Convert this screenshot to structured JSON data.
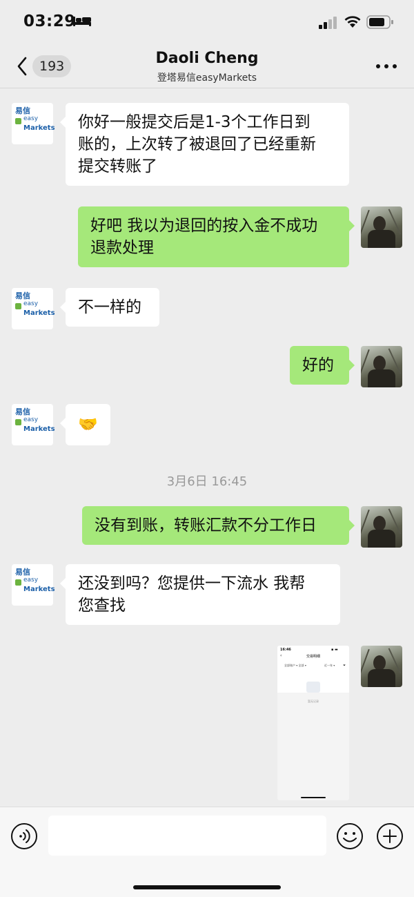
{
  "status_bar": {
    "time": "03:29",
    "sleep_icon": "bed-icon",
    "signal_icon": "cellular-signal-icon",
    "wifi_icon": "wifi-icon",
    "battery_icon": "battery-icon"
  },
  "nav": {
    "unread_count": "193",
    "title": "Daoli Cheng",
    "subtitle": "登塔易信easyMarkets",
    "back_icon": "chevron-left-icon",
    "more_icon": "more-dots-icon"
  },
  "logo": {
    "cn": "易信",
    "easy": "easy",
    "markets": "Markets"
  },
  "messages": [
    {
      "side": "in",
      "lines": [
        "你好一般提交后是1-3个工作日到",
        "账的，上次转了被退回了已经重新",
        "提交转账了"
      ]
    },
    {
      "side": "out",
      "lines": [
        "好吧 我以为退回的按入金不成功",
        "退款处理"
      ]
    },
    {
      "side": "in",
      "lines": [
        "不一样的"
      ]
    },
    {
      "side": "out",
      "lines": [
        "好的"
      ]
    },
    {
      "side": "in",
      "emoji": "🤝"
    },
    {
      "side": "out",
      "lines": [
        "没有到账，转账汇款不分工作日"
      ]
    },
    {
      "side": "in",
      "lines": [
        "还没到吗？您提供一下流水  我帮",
        "您查找"
      ]
    }
  ],
  "timestamp": "3月6日 16:45",
  "image_message": {
    "time": "16:46",
    "title": "交易明细",
    "back": "‹",
    "filter_left": "全部账户 ▾ 全部 ▾",
    "filter_right": "近一年 ▾",
    "filter_icon": "filter-icon",
    "empty_text": "暂无记录"
  },
  "input_bar": {
    "voice_icon": "voice-icon",
    "emoji_icon": "emoji-smile-icon",
    "plus_icon": "plus-circle-icon",
    "input_value": ""
  },
  "colors": {
    "outgoing_bubble": "#a5e87a",
    "incoming_bubble": "#ffffff",
    "background": "#ededed"
  }
}
